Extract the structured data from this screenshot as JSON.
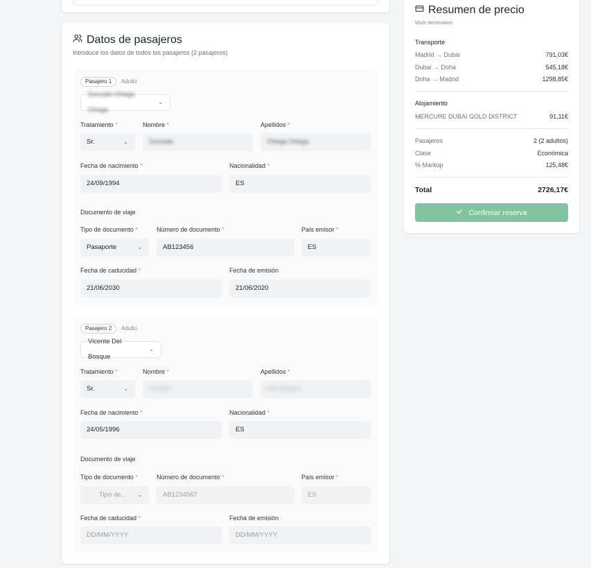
{
  "passengers_section": {
    "title": "Datos de pasajeros",
    "subtitle": "Introduce los datos de todos los pasajeros (2 pasajeros)"
  },
  "labels": {
    "treatment": "Tratamiento",
    "first_name": "Nombre",
    "last_name": "Apellidos",
    "birth_date": "Fecha de nacimiento",
    "nationality": "Nacionalidad",
    "travel_document": "Documento de viaje",
    "doc_type": "Tipo de documento",
    "doc_number": "Número de documento",
    "issuing_country": "País emisor",
    "expiry_date": "Fecha de caducidad",
    "issue_date": "Fecha de emisión",
    "required_mark": "*"
  },
  "passengers": [
    {
      "badge": "Pasajero 1",
      "type": "Adulto",
      "selected_traveler": "Gonzalo Ortega Ortega",
      "treatment": "Sr.",
      "first_name": "Gonzalo",
      "last_name": "Ortega Ortega",
      "birth_date": "24/09/1994",
      "nationality": "ES",
      "doc_type": "Pasaporte",
      "doc_number": "AB123456",
      "issuing_country": "ES",
      "expiry_date": "21/06/2030",
      "issue_date": "21/06/2020"
    },
    {
      "badge": "Pasajero 2",
      "type": "Adulto",
      "selected_traveler": "Vicente Del Bosque",
      "treatment": "Sr.",
      "first_name": "Vicente",
      "last_name": "Del Bosque",
      "birth_date": "24/05/1996",
      "nationality": "ES",
      "doc_type_placeholder": "Tipo de...",
      "doc_number_placeholder": "AB1234567",
      "issuing_country_placeholder": "ES",
      "expiry_date_placeholder": "DD/MM/YYYY",
      "issue_date_placeholder": "DD/MM/YYYY"
    }
  ],
  "price_summary": {
    "title": "Resumen de precio",
    "subtitle": "Multi-destination",
    "transport_heading": "Transporte",
    "transport": [
      {
        "route": "Madrid → Dubai",
        "price": "791,03€"
      },
      {
        "route": "Dubai → Doha",
        "price": "545,18€"
      },
      {
        "route": "Doha → Madrid",
        "price": "1298,85€"
      }
    ],
    "lodging_heading": "Alojamiento",
    "lodging": [
      {
        "name": "MERCURE DUBAI GOLD DISTRICT",
        "price": "91,11€"
      }
    ],
    "details": [
      {
        "label": "Pasajeros",
        "value": "2 (2 adultos)"
      },
      {
        "label": "Clase",
        "value": "Económica"
      },
      {
        "label": "% Markup",
        "value": "125,48€"
      }
    ],
    "total_label": "Total",
    "total_value": "2726,17€",
    "confirm_label": "Confirmar reserva"
  },
  "icons": {
    "users": "users-icon",
    "card": "credit-card-icon",
    "check": "check-icon",
    "chevron": "chevron-down-icon"
  },
  "colors": {
    "confirm_button": "#82c4a2"
  }
}
